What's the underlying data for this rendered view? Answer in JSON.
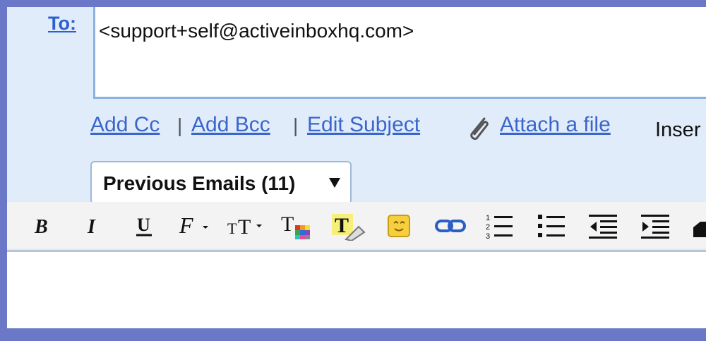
{
  "compose": {
    "to_label": "To:",
    "to_value": "<support+self@activeinboxhq.com>"
  },
  "links": {
    "add_cc": "Add Cc",
    "add_bcc": "Add Bcc",
    "edit_subject": "Edit Subject",
    "attach_file": "Attach a file",
    "insert": "Inser",
    "separator": "|"
  },
  "previous_emails": {
    "label": "Previous Emails (11)"
  },
  "toolbar": {
    "buttons": [
      "bold-icon",
      "italic-icon",
      "underline-icon",
      "font-icon",
      "text-size-icon",
      "text-color-icon",
      "highlight-color-icon",
      "emoticon-icon",
      "link-icon",
      "numbered-list-icon",
      "bulleted-list-icon",
      "indent-less-icon",
      "indent-more-icon",
      "quote-icon"
    ]
  },
  "colors": {
    "frame": "#6b78c8",
    "panel": "#e0ecfa",
    "link": "#3a66cc"
  }
}
